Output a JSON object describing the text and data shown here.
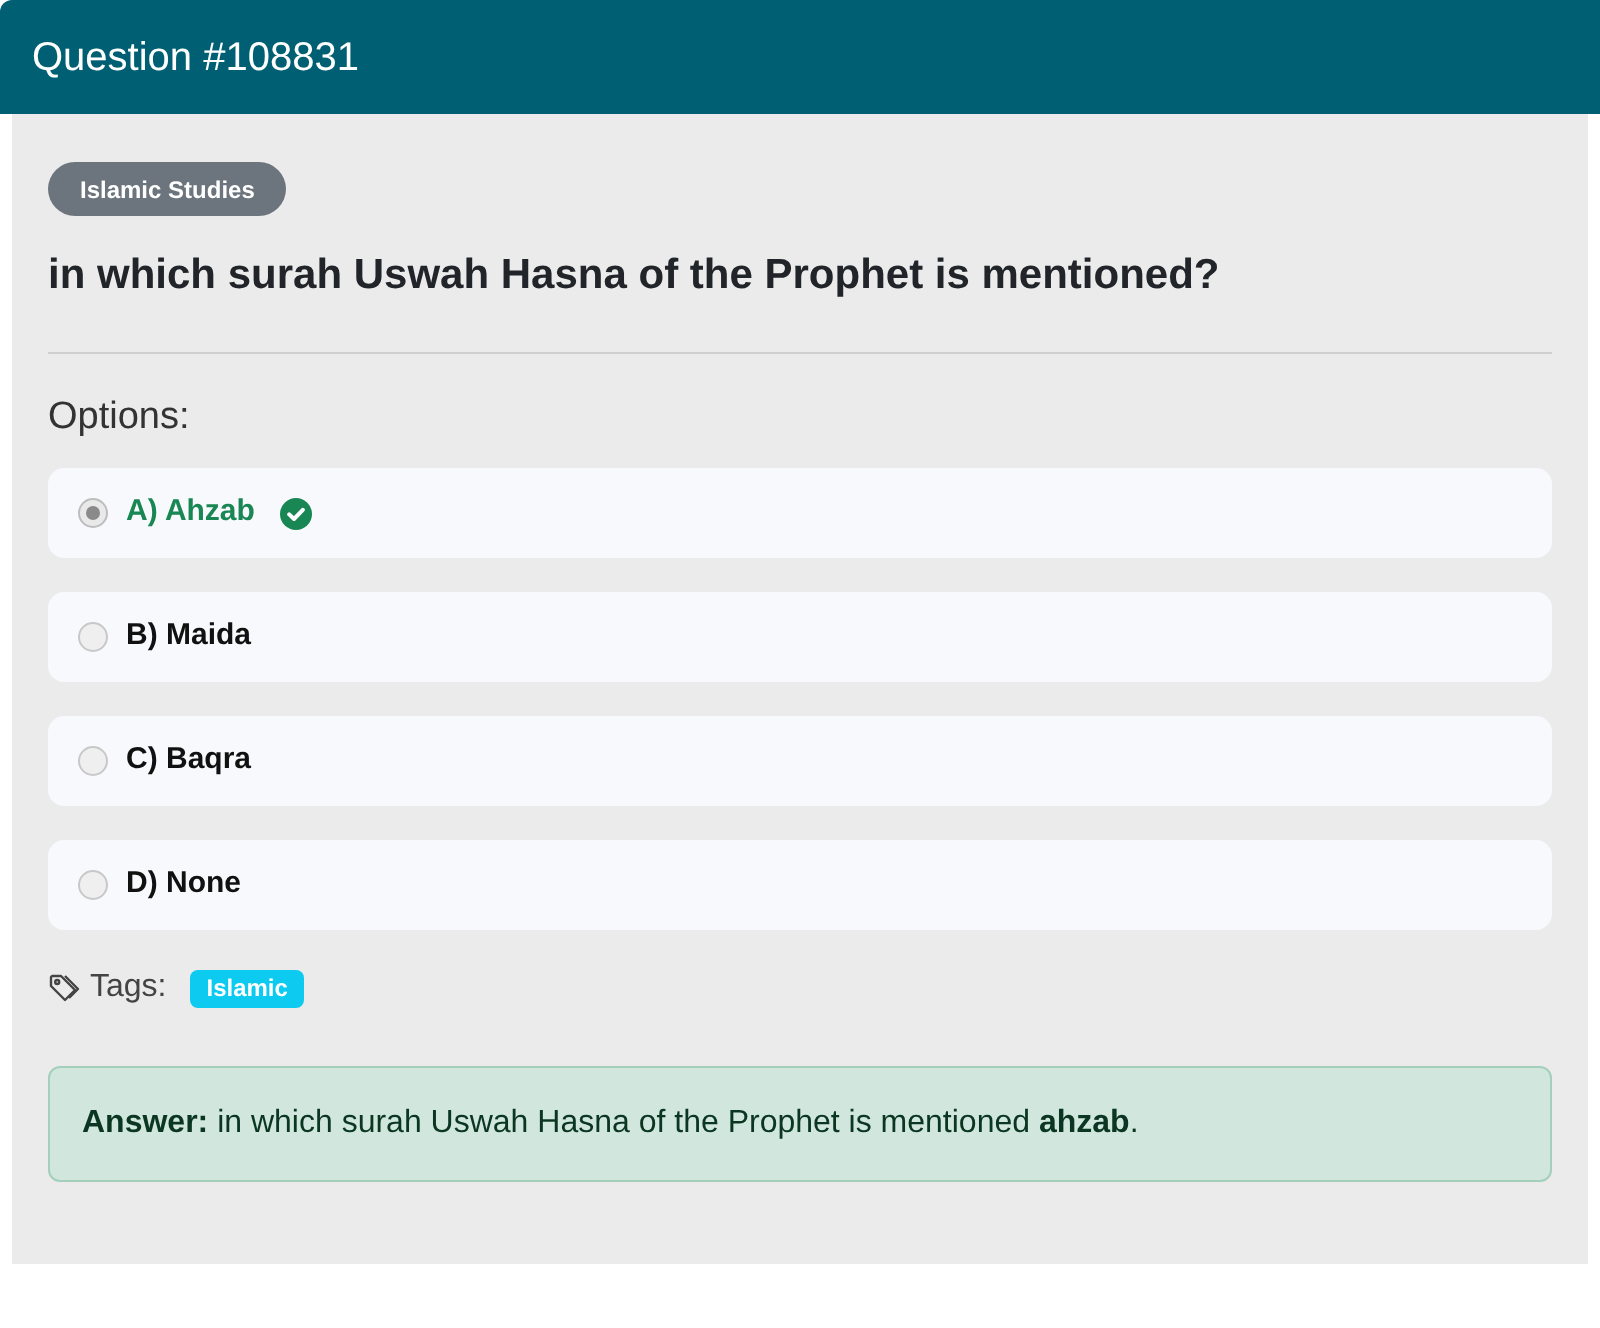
{
  "header": {
    "title": "Question #108831"
  },
  "category": "Islamic Studies",
  "question": "in which surah Uswah Hasna of the Prophet is mentioned?",
  "options_label": "Options:",
  "options": [
    {
      "label": "A) Ahzab",
      "selected": true,
      "correct": true
    },
    {
      "label": "B) Maida",
      "selected": false,
      "correct": false
    },
    {
      "label": "C) Baqra",
      "selected": false,
      "correct": false
    },
    {
      "label": "D) None",
      "selected": false,
      "correct": false
    }
  ],
  "tags": {
    "label": "Tags:",
    "items": [
      "Islamic"
    ]
  },
  "answer": "**Answer:** in which surah Uswah Hasna of the Prophet is mentioned **ahzab**."
}
